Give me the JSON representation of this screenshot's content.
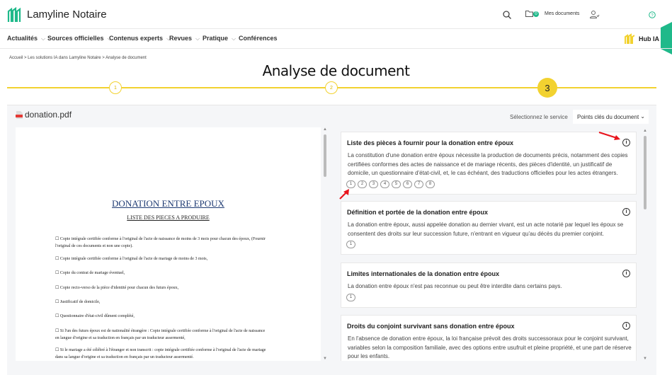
{
  "header": {
    "brand": "Lamyline Notaire",
    "my_documents": "Mes documents",
    "documents_count": "0",
    "hub": "Hub IA"
  },
  "nav": [
    "Actualités",
    "Sources officielles",
    "Contenus experts",
    "Revues",
    "Pratique",
    "Conférences"
  ],
  "breadcrumb": "Accueil > Les solutions IA dans Lamyline Notaire > Analyse de document",
  "title": "Analyse de document",
  "steps": [
    "1",
    "2",
    "3"
  ],
  "panel": {
    "file": "donation.pdf",
    "service_label": "Sélectionnez le service",
    "service_value": "Points clés du document"
  },
  "doc": {
    "title": "DONATION ENTRE EPOUX",
    "subtitle": "LISTE DES PIECES A PRODUIRE",
    "items": [
      "☐ Copie intégrale certifiée conforme à l'original de l'acte de naissance de moins de 3 mois pour chacun des époux, (Fournir l'original de ces documents et non une copie).",
      "☐ Copie intégrale certifiée conforme à l'original de l'acte de mariage de moins de 3 mois,",
      "☐ Copie du contrat de mariage éventuel,",
      "☐ Copie recto-verso de la pièce d'identité pour chacun des futurs époux,",
      "☐ Justificatif de domicile,",
      "☐ Questionnaire d'état-civil dûment complété,",
      "☐ Si l'un des futurs époux est de nationalité étrangère : Copie intégrale certifiée conforme à l'original de l'acte de naissance en langue d'origine et sa traduction en français par un traducteur assermenté,",
      "☐ Si le mariage a été célébré à l'étranger et non transcrit : copie intégrale certifiée conforme à l'original de l'acte de mariage dans sa langue d'origine et sa traduction en français par un traducteur assermenté."
    ]
  },
  "cards": [
    {
      "title": "Liste des pièces à fournir pour la donation entre époux",
      "body": "La constitution d'une donation entre époux nécessite la production de documents précis, notamment des copies certifiées conformes des actes de naissance et de mariage récents, des pièces d'identité, un justificatif de domicile, un questionnaire d'état-civil, et, le cas échéant, des traductions officielles pour les actes étrangers.",
      "refs": [
        "1",
        "2",
        "3",
        "4",
        "5",
        "6",
        "7",
        "8"
      ]
    },
    {
      "title": "Définition et portée de la donation entre époux",
      "body": "La donation entre époux, aussi appelée donation au dernier vivant, est un acte notarié par lequel les époux se consentent des droits sur leur succession future, n'entrant en vigueur qu'au décès du premier conjoint.",
      "refs": [
        "1"
      ]
    },
    {
      "title": "Limites internationales de la donation entre époux",
      "body": "La donation entre époux n'est pas reconnue ou peut être interdite dans certains pays.",
      "refs": [
        "1"
      ]
    },
    {
      "title": "Droits du conjoint survivant sans donation entre époux",
      "body": "En l'absence de donation entre époux, la loi française prévoit des droits successoraux pour le conjoint survivant, variables selon la composition familiale, avec des options entre usufruit et pleine propriété, et une part de réserve pour les enfants.",
      "refs": []
    }
  ],
  "colors": {
    "accent": "#f2d230",
    "brand": "#1fb98a",
    "arrow": "#e8141c"
  }
}
